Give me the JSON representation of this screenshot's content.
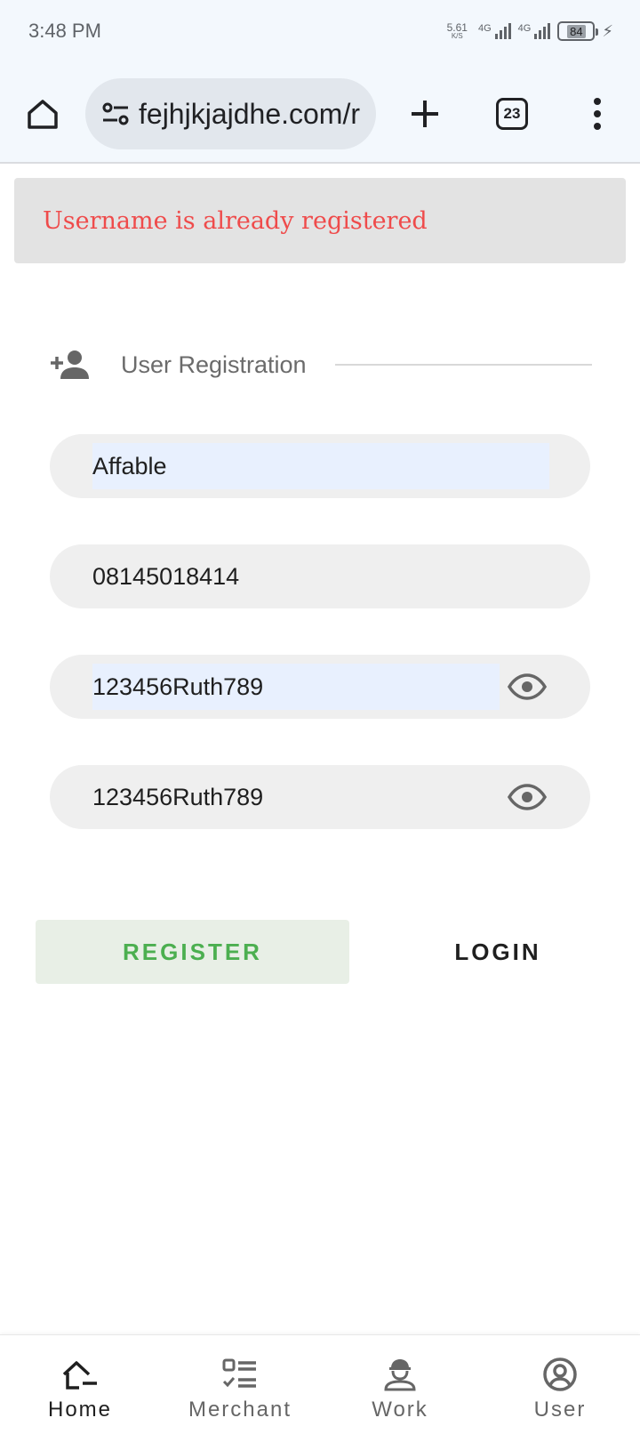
{
  "status_bar": {
    "time": "3:48 PM",
    "net_speed_value": "5.61",
    "net_speed_unit": "K/S",
    "sim1_label": "4G",
    "sim2_label": "4G",
    "battery": "84"
  },
  "browser": {
    "url": "fejhjkjajdhe.com/r",
    "tab_count": "23"
  },
  "error": {
    "message": "Username is already registered"
  },
  "section": {
    "title": "User Registration"
  },
  "form": {
    "username": "Affable",
    "phone": "08145018414",
    "password": "123456Ruth789",
    "confirm_password": "123456Ruth789"
  },
  "buttons": {
    "register": "REGISTER",
    "login": "LOGIN"
  },
  "bottom_nav": {
    "items": [
      {
        "label": "Home",
        "icon": "home-icon"
      },
      {
        "label": "Merchant",
        "icon": "checklist-icon"
      },
      {
        "label": "Work",
        "icon": "engineer-icon"
      },
      {
        "label": "User",
        "icon": "account-circle-icon"
      }
    ],
    "active": "Home"
  },
  "colors": {
    "error_text": "#ef4b4b",
    "register_text": "#4caf50",
    "register_bg": "#e8efe6",
    "browser_bg": "#f3f8fd"
  }
}
